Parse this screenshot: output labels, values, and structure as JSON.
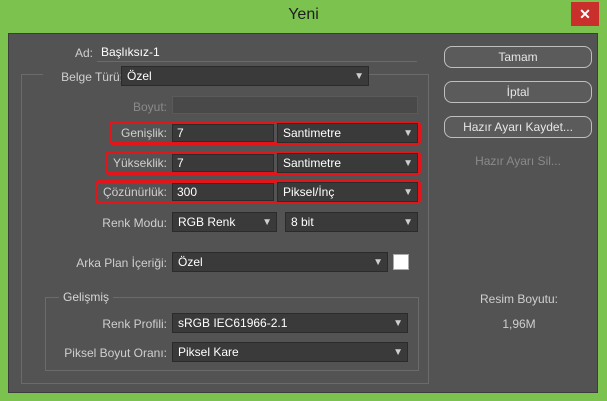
{
  "window": {
    "title": "Yeni",
    "close_glyph": "✕"
  },
  "form": {
    "ad_label": "Ad:",
    "ad_value": "Başlıksız-1",
    "belge_turu_label": "Belge Türü:",
    "belge_turu_value": "Özel",
    "boyut_label": "Boyut:",
    "genislik_label": "Genişlik:",
    "genislik_value": "7",
    "genislik_unit": "Santimetre",
    "yukseklik_label": "Yükseklik:",
    "yukseklik_value": "7",
    "yukseklik_unit": "Santimetre",
    "cozunurluk_label": "Çözünürlük:",
    "cozunurluk_value": "300",
    "cozunurluk_unit": "Piksel/İnç",
    "renk_modu_label": "Renk Modu:",
    "renk_modu_value": "RGB Renk",
    "bit_value": "8 bit",
    "arka_plan_label": "Arka Plan İçeriği:",
    "arka_plan_value": "Özel",
    "gelismis_label": "Gelişmiş",
    "renk_profili_label": "Renk Profili:",
    "renk_profili_value": "sRGB IEC61966-2.1",
    "piksel_oran_label": "Piksel Boyut Oranı:",
    "piksel_oran_value": "Piksel Kare"
  },
  "buttons": {
    "tamam": "Tamam",
    "iptal": "İptal",
    "kaydet": "Hazır Ayarı Kaydet...",
    "sil": "Hazır Ayarı Sil..."
  },
  "info": {
    "resim_boyutu_label": "Resim Boyutu:",
    "resim_boyutu_value": "1,96M"
  },
  "colors": {
    "highlight": "#e3141a",
    "dialog_bg": "#535353",
    "titlebar": "#7cc24f"
  }
}
